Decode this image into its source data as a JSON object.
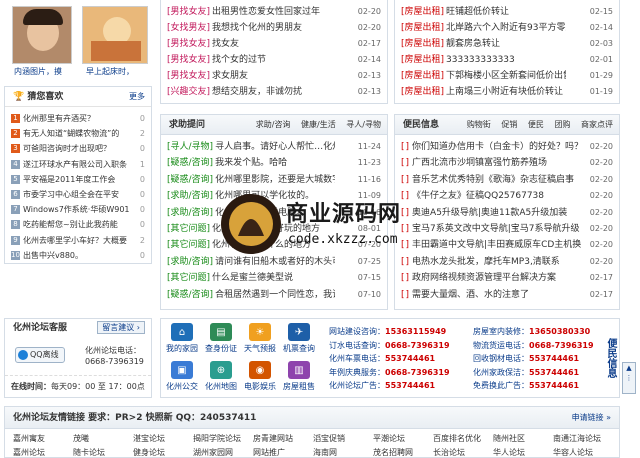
{
  "avatars": [
    {
      "caption": "内涵图片，摸",
      "color": "#b28a6a"
    },
    {
      "caption": "早上起床时，",
      "color": "#d9a066"
    }
  ],
  "hot": {
    "title": "猜您喜欢",
    "more": "更多",
    "items": [
      {
        "rank": "1",
        "text": "化州那里有卉酒买？",
        "count": "0"
      },
      {
        "rank": "2",
        "text": "有无人知道“蝴蝶农物流”的",
        "count": "2"
      },
      {
        "rank": "3",
        "text": "可爸阳咨询时才出现吧？",
        "count": "0"
      },
      {
        "rank": "4",
        "text": "遂江环球水产有限公司入职条",
        "count": "1"
      },
      {
        "rank": "5",
        "text": "平安福是2011年度工作会",
        "count": "0"
      },
      {
        "rank": "6",
        "text": "市委学习中心组全会在平安",
        "count": "0"
      },
      {
        "rank": "7",
        "text": "Windows7作系统·华硕W901",
        "count": "0"
      },
      {
        "rank": "8",
        "text": "吃药能帮您~别让此我药能",
        "count": "0"
      },
      {
        "rank": "9",
        "text": "化州去哪里学小车好？大概要",
        "count": "2"
      },
      {
        "rank": "10",
        "text": "出售中兴v880。",
        "count": "0"
      }
    ]
  },
  "friends": {
    "items": [
      {
        "tag": "[男找女友]",
        "text": "出租男性恋爱女性回家过年",
        "date": "02-20"
      },
      {
        "tag": "[女找男友]",
        "text": "我想找个化州的男朋友",
        "date": "02-20"
      },
      {
        "tag": "[男找女友]",
        "text": "找女友",
        "date": "02-17"
      },
      {
        "tag": "[男找女友]",
        "text": "找个女的过节",
        "date": "02-14"
      },
      {
        "tag": "[男找女友]",
        "text": "求女朋友",
        "date": "02-13"
      },
      {
        "tag": "[兴趣交友]",
        "text": "想结交朋友，非诚勿扰",
        "date": "02-13"
      }
    ]
  },
  "rent": {
    "items": [
      {
        "tag": "[房屋出租]",
        "text": "旺铺超低价转让",
        "date": "02-15"
      },
      {
        "tag": "[房屋出租]",
        "text": "北岸路六个入附近有93平方零房地",
        "date": "02-14"
      },
      {
        "tag": "[房屋出租]",
        "text": "靓套房急转让",
        "date": "02-03"
      },
      {
        "tag": "[房屋出租]",
        "text": "333333333333",
        "date": "02-01"
      },
      {
        "tag": "[房屋出租]",
        "text": "下郭梅楼小区全新套间低价出售",
        "date": "01-29"
      },
      {
        "tag": "[房屋出租]",
        "text": "上南塌三小附近有块低价转让",
        "date": "01-19"
      }
    ]
  },
  "qa": {
    "title": "求助提问",
    "tabs": [
      "求助/咨询",
      "健康/生活",
      "寻人/寻物"
    ],
    "items": [
      {
        "tag": "[寻人/寻物]",
        "text": "寻人启事。请好心人帮忙…化州",
        "date": "11-24"
      },
      {
        "tag": "[疑惑/咨询]",
        "text": "我来发个贴。哈哈",
        "date": "11-23"
      },
      {
        "tag": "[疑惑/咨询]",
        "text": "化州哪里影院，还要是大城数字影",
        "date": "11-16"
      },
      {
        "tag": "[求助/咨询]",
        "text": "化州哪里可以学化妆的。",
        "date": "11-09"
      },
      {
        "tag": "[求助/咨询]",
        "text": "化州哪里可以学电脑。",
        "date": "10-16"
      },
      {
        "tag": "[其它问题]",
        "text": "化州有没有什么好玩的地方",
        "date": "08-01"
      },
      {
        "tag": "[其它问题]",
        "text": "化州有没有卖什么的地方",
        "date": "07-20"
      },
      {
        "tag": "[求助/咨询]",
        "text": "请问谁有旧船木或者好的木头可以",
        "date": "07-25"
      },
      {
        "tag": "[其它问题]",
        "text": "什么是蜜兰德美型说",
        "date": "07-15"
      },
      {
        "tag": "[疑惑/咨询]",
        "text": "合租居然遇到一个同性恋，我该怎",
        "date": "07-10"
      }
    ]
  },
  "news": {
    "title": "便民信息",
    "tabs": [
      "购物街",
      "促销",
      "便民",
      "团购",
      "商家点评"
    ],
    "items": [
      {
        "text": "你们知道办信用卡（白金卡）的好处？吗？",
        "date": "02-20"
      },
      {
        "text": "广西北流市沙垌镇富强竹筋养殖场",
        "date": "02-20"
      },
      {
        "text": "音乐艺术优秀特别《歌海》杂志征稿启事",
        "date": "02-20"
      },
      {
        "text": "《牛仔之友》征稿QQ25767738",
        "date": "02-20"
      },
      {
        "text": "奥迪A5升级导航|奥迪11款A5升级加装",
        "date": "02-20"
      },
      {
        "text": "宝马7系英文改中文导航|宝马7系导航升级",
        "date": "02-20"
      },
      {
        "text": "丰田霸道中文导航|丰田赛威原车CD主机换",
        "date": "02-20"
      },
      {
        "text": "电热水龙头批发，摩托车MP3,清联系",
        "date": "02-20"
      },
      {
        "text": "政府网络视频资源管理平台解决方案",
        "date": "02-17"
      },
      {
        "text": "需要大量烟、酒、水的注意了",
        "date": "02-17"
      }
    ]
  },
  "service": {
    "title": "化州论坛客服",
    "button": "留言建议 ›",
    "qq_label": "QQ离线",
    "phone_label": "化州论坛电话：",
    "phone": "0668-7396319",
    "hours_label": "在线时间：",
    "hours": "每天09：00 至 17：00点"
  },
  "icons": [
    {
      "label": "我的家园",
      "glyph": "⌂",
      "color": "#1f6fb8",
      "name": "home-icon"
    },
    {
      "label": "查身份证",
      "glyph": "▤",
      "color": "#2e8b57",
      "name": "id-card-icon"
    },
    {
      "label": "天气预报",
      "glyph": "☀",
      "color": "#f0a020",
      "name": "weather-icon"
    },
    {
      "label": "机票查询",
      "glyph": "✈",
      "color": "#1e5fa8",
      "name": "plane-icon"
    },
    {
      "label": "化州公交",
      "glyph": "▣",
      "color": "#3a7bd5",
      "name": "bus-icon"
    },
    {
      "label": "化州地图",
      "glyph": "⊕",
      "color": "#2a9d8f",
      "name": "map-icon"
    },
    {
      "label": "电影娱乐",
      "glyph": "◉",
      "color": "#d35400",
      "name": "film-icon"
    },
    {
      "label": "房屋租售",
      "glyph": "▥",
      "color": "#8e44ad",
      "name": "house-icon"
    }
  ],
  "contacts_left": [
    {
      "label": "网站建设咨询：",
      "phone": "15363115949"
    },
    {
      "label": "订水电话查询：",
      "phone": "0668-7396319"
    },
    {
      "label": "化州车票电话：",
      "phone": "553744461"
    },
    {
      "label": "年例庆典服务：",
      "phone": "0668-7396319"
    },
    {
      "label": "化州论坛广告：",
      "phone": "553744461"
    }
  ],
  "contacts_right": [
    {
      "label": "房屋室内装修：",
      "phone": "13650380330"
    },
    {
      "label": "物流货运电话：",
      "phone": "0668-7396319"
    },
    {
      "label": "回收钢材电话：",
      "phone": "553744461"
    },
    {
      "label": "化州家政保洁：",
      "phone": "553744461"
    },
    {
      "label": "免费换此广告：",
      "phone": "553744461"
    }
  ],
  "side_tab": "便民信息",
  "links": {
    "title": "化州论坛友情链接  要求：PR>2 快照新  QQ：240537411",
    "apply": "申请链接 »",
    "row1": [
      "嘉州寓友",
      "茂曦",
      "湛宝论坛",
      "揭阳学院论坛",
      "房青建网站",
      "滔宝促销",
      "平潮论坛",
      "百度排名优化",
      "随州社区",
      "南通江海论坛"
    ],
    "row2": [
      "嘉州论坛",
      "随卡论坛",
      "健身论坛",
      "湖州家园网",
      "网站推广",
      "海南网",
      "茂名招聘网",
      "长治论坛",
      "华人论坛",
      "华容人论坛"
    ]
  },
  "watermark": {
    "title": "商业源码网",
    "url": "code.xkzzz.com"
  }
}
